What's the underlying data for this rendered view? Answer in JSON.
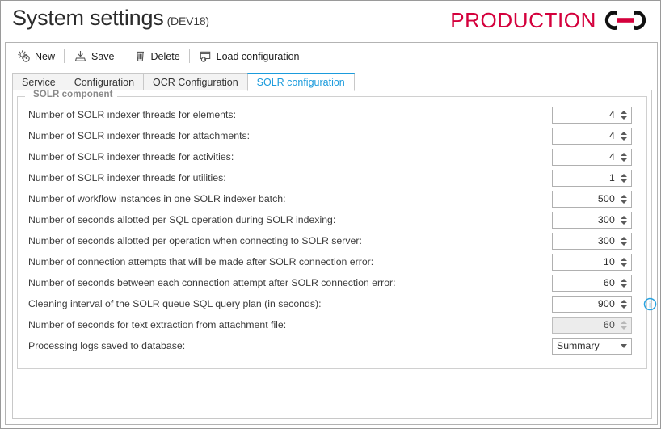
{
  "header": {
    "title": "System settings",
    "environment": "(DEV18)",
    "brand_word": "PRODUCTION",
    "brand_mark": "interlocking-rings-logo",
    "brand_color": "#d4003c"
  },
  "toolbar": {
    "buttons": [
      {
        "label": "New",
        "icon": "new-gear-icon"
      },
      {
        "label": "Save",
        "icon": "save-icon"
      },
      {
        "label": "Delete",
        "icon": "trash-icon"
      },
      {
        "label": "Load configuration",
        "icon": "load-configuration-icon"
      }
    ]
  },
  "tabs": {
    "items": [
      {
        "label": "Service",
        "active": false
      },
      {
        "label": "Configuration",
        "active": false
      },
      {
        "label": "OCR Configuration",
        "active": false
      },
      {
        "label": "SOLR configuration",
        "active": true
      }
    ],
    "active_color": "#1b9bdc"
  },
  "groupbox": {
    "legend": "SOLR component"
  },
  "settings": {
    "rows": [
      {
        "label": "Number of SOLR indexer threads for elements:",
        "value": "4",
        "control": "spinner",
        "disabled": false,
        "info": false
      },
      {
        "label": "Number of SOLR indexer threads for attachments:",
        "value": "4",
        "control": "spinner",
        "disabled": false,
        "info": false
      },
      {
        "label": "Number of SOLR indexer threads for activities:",
        "value": "4",
        "control": "spinner",
        "disabled": false,
        "info": false
      },
      {
        "label": "Number of SOLR indexer threads for utilities:",
        "value": "1",
        "control": "spinner",
        "disabled": false,
        "info": false
      },
      {
        "label": "Number of workflow instances in one SOLR indexer batch:",
        "value": "500",
        "control": "spinner",
        "disabled": false,
        "info": false
      },
      {
        "label": "Number of seconds allotted per SQL operation during SOLR indexing:",
        "value": "300",
        "control": "spinner",
        "disabled": false,
        "info": false
      },
      {
        "label": "Number of seconds allotted per operation when connecting to SOLR server:",
        "value": "300",
        "control": "spinner",
        "disabled": false,
        "info": false
      },
      {
        "label": "Number of connection attempts that will be made after SOLR connection error:",
        "value": "10",
        "control": "spinner",
        "disabled": false,
        "info": false
      },
      {
        "label": "Number of seconds between each connection attempt after SOLR connection error:",
        "value": "60",
        "control": "spinner",
        "disabled": false,
        "info": false
      },
      {
        "label": "Cleaning interval of the SOLR queue SQL query plan (in seconds):",
        "value": "900",
        "control": "spinner",
        "disabled": false,
        "info": true
      },
      {
        "label": "Number of seconds for text extraction from attachment file:",
        "value": "60",
        "control": "spinner",
        "disabled": true,
        "info": false
      },
      {
        "label": "Processing logs saved to database:",
        "value": "Summary",
        "control": "combobox",
        "disabled": false,
        "info": false
      }
    ]
  }
}
